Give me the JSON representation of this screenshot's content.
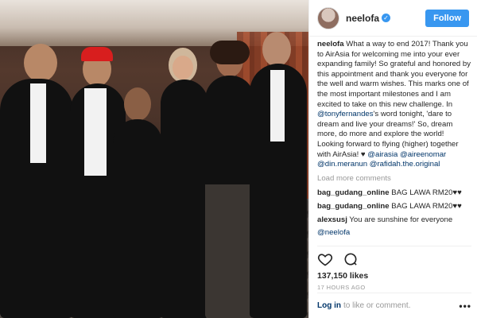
{
  "post": {
    "username": "neelofa",
    "verified_icon": "verified-badge-icon",
    "follow_label": "Follow",
    "caption_user": "neelofa",
    "caption_text_1": " What a way to end 2017! Thank you to AirAsia for welcoming me into your ever expanding family! So grateful and honored by this appointment and thank you everyone for the well and warm wishes. This marks one of the most important milestones and I am excited to take on this new challenge. In ",
    "caption_mention_1": "@tonyfernandes",
    "caption_text_2": "'s word tonight, 'dare to dream and live your dreams!' So, dream more, do more and explore the world! Looking forward to flying (higher) together with AirAsia! ♥",
    "mentions": [
      "@airasia",
      "@aireenomar",
      "@din.meranun",
      "@rafidah.the.original"
    ],
    "load_more": "Load more comments",
    "comments": [
      {
        "user": "bag_gudang_online",
        "text": "BAG LAWA RM20♥♥"
      },
      {
        "user": "bag_gudang_online",
        "text": "BAG LAWA RM20♥♥"
      },
      {
        "user": "alexsusj",
        "text": "You are sunshine for everyone"
      },
      {
        "user": "",
        "text": "@neelofa"
      }
    ],
    "likes": "137,150 likes",
    "time": "17 HOURS AGO",
    "login_label": "Log in",
    "login_suffix": "to like or comment.",
    "more_label": "•••"
  },
  "icons": {
    "like": "heart-icon",
    "comment": "comment-icon",
    "more": "more-options-icon"
  },
  "colors": {
    "accent": "#3897f0",
    "link": "#003569",
    "muted": "#999999"
  }
}
